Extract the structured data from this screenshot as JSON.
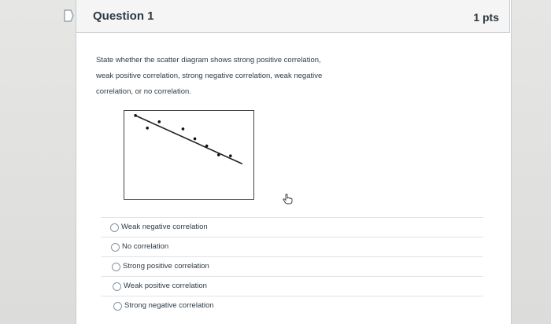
{
  "question": {
    "title": "Question 1",
    "points": "1 pts",
    "flag_icon": "flag-icon",
    "prompt": "State whether the scatter diagram shows strong positive correlation, weak positive correlation, strong negative correlation, weak negative correlation, or no correlation."
  },
  "scatter": {
    "points": [
      {
        "x": 1,
        "y": 9.4
      },
      {
        "x": 2,
        "y": 8.0
      },
      {
        "x": 3,
        "y": 8.7
      },
      {
        "x": 5,
        "y": 7.9
      },
      {
        "x": 6,
        "y": 6.8
      },
      {
        "x": 7,
        "y": 6.0
      },
      {
        "x": 8,
        "y": 5.0
      },
      {
        "x": 9,
        "y": 4.9
      }
    ],
    "trend_line": {
      "from": {
        "x": 1,
        "y": 9.4
      },
      "to": {
        "x": 10,
        "y": 4.0
      }
    },
    "xlim": [
      0,
      11
    ],
    "ylim": [
      0,
      10
    ]
  },
  "answers": [
    {
      "label": "Weak negative correlation"
    },
    {
      "label": "No correlation"
    },
    {
      "label": "Strong positive correlation"
    },
    {
      "label": "Weak positive correlation"
    },
    {
      "label": "Strong negative correlation"
    }
  ],
  "colors": {
    "header_bg": "#f5f5f5",
    "text": "#2d3b45",
    "border": "#c7cdd1"
  }
}
